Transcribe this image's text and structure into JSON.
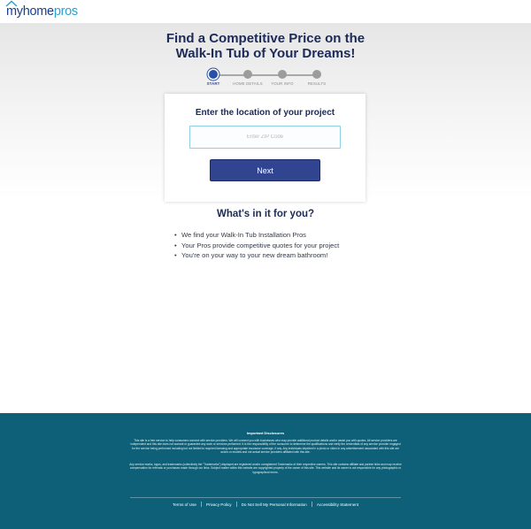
{
  "header": {
    "logo": {
      "my": "my",
      "home": "home",
      "pros": "pros"
    }
  },
  "hero": {
    "title_line1": "Find a Competitive Price on the",
    "title_line2": "Walk-In Tub of Your Dreams!"
  },
  "progress": {
    "current_step": 1,
    "steps": [
      {
        "label": "START",
        "active": true
      },
      {
        "label": "HOME DETAILS",
        "active": false
      },
      {
        "label": "YOUR INFO",
        "active": false
      },
      {
        "label": "RESULTS",
        "active": false
      }
    ]
  },
  "form": {
    "title": "Enter the location of your project",
    "zip_placeholder": "Enter ZIP Code",
    "zip_value": "",
    "next_label": "Next"
  },
  "benefits": {
    "title": "What's in it for you?",
    "items": [
      "We find your Walk-In Tub Installation Pros",
      "Your Pros provide competitive quotes for your project",
      "You're on your way to your new dream bathroom!"
    ]
  },
  "footer": {
    "disclosure_title": "Important Disclosures",
    "disclosure_p1": "This site is a free service to help consumers connect with service providers. We will connect you with businesses who may provide additional product details and/or assist you with quotes. All service providers are independent and this site does not warrant or guarantee any work or services performed. It is the responsibility of the consumer to determine the qualifications and verify the credentials of any service provider engaged for the service being performed including but not limited to required licensing and appropriate insurance coverage, if any. Any individuals depicted in a photo or video in any advertisement associated with this site are actors or models and not actual service providers affiliated with this site.",
    "disclosure_p2": "Any service marks, logos, and trademarks (collectively the \"Trademarks\") displayed are registered and/or unregistered Trademarks of their respective owners. This site contains affiliate and partner links and may receive compensation for referrals or purchases made through our links. Subject matter within this website are copyrighted property of the owner of this site. This website and its owner is not responsible for any photographic or typographical errors.",
    "links": {
      "terms": "Terms of Use",
      "privacy": "Privacy Policy",
      "do_not_sell": "Do Not Sell My Personal Information",
      "accessibility": "Accessibility Statement"
    }
  },
  "colors": {
    "brand_navy": "#1b2a56",
    "button": "#30448f",
    "step_active": "#2a4fa6",
    "footer_bg": "#0e6078",
    "logo_accent": "#2e9fd1"
  }
}
